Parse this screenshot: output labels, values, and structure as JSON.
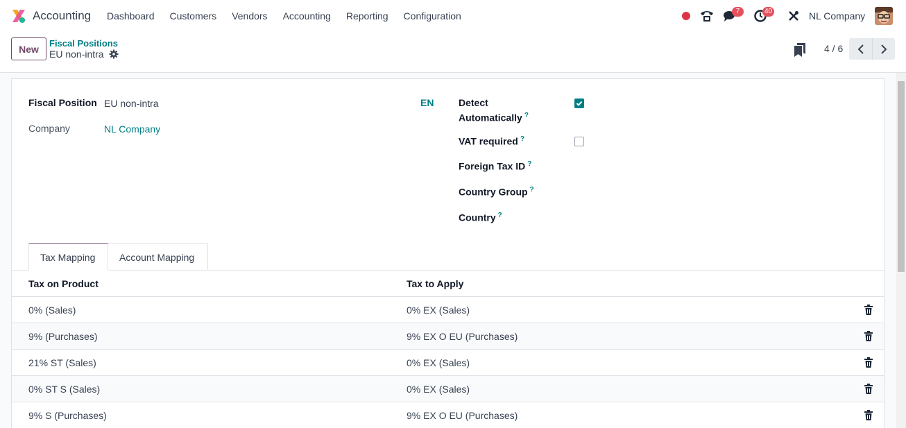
{
  "navbar": {
    "app_name": "Accounting",
    "menu": [
      "Dashboard",
      "Customers",
      "Vendors",
      "Accounting",
      "Reporting",
      "Configuration"
    ],
    "messages_badge": "7",
    "activities_badge": "40",
    "company": "NL Company"
  },
  "control_panel": {
    "new_label": "New",
    "breadcrumb_parent": "Fiscal Positions",
    "breadcrumb_current": "EU non-intra",
    "pager": "4 / 6"
  },
  "form": {
    "fiscal_position_label": "Fiscal Position",
    "fiscal_position_value": "EU non-intra",
    "lang_code": "EN",
    "company_label": "Company",
    "company_value": "NL Company",
    "detect_label_line1": "Detect",
    "detect_label_line2": "Automatically",
    "detect_checked": true,
    "vat_required_label": "VAT required",
    "vat_required_checked": false,
    "foreign_tax_label": "Foreign Tax ID",
    "country_group_label": "Country Group",
    "country_label": "Country",
    "help_mark": "?"
  },
  "tabs": [
    "Tax Mapping",
    "Account Mapping"
  ],
  "table": {
    "headers": [
      "Tax on Product",
      "Tax to Apply"
    ],
    "rows": [
      {
        "src": "0% (Sales)",
        "dest": "0% EX (Sales)"
      },
      {
        "src": "9% (Purchases)",
        "dest": "9% EX O EU (Purchases)"
      },
      {
        "src": "21% ST (Sales)",
        "dest": "0% EX (Sales)"
      },
      {
        "src": "0% ST S (Sales)",
        "dest": "0% EX (Sales)"
      },
      {
        "src": "9% S (Purchases)",
        "dest": "9% EX O EU (Purchases)"
      }
    ]
  },
  "colors": {
    "brand": "#714b67",
    "link": "#017e84",
    "badge": "#e4515d"
  }
}
